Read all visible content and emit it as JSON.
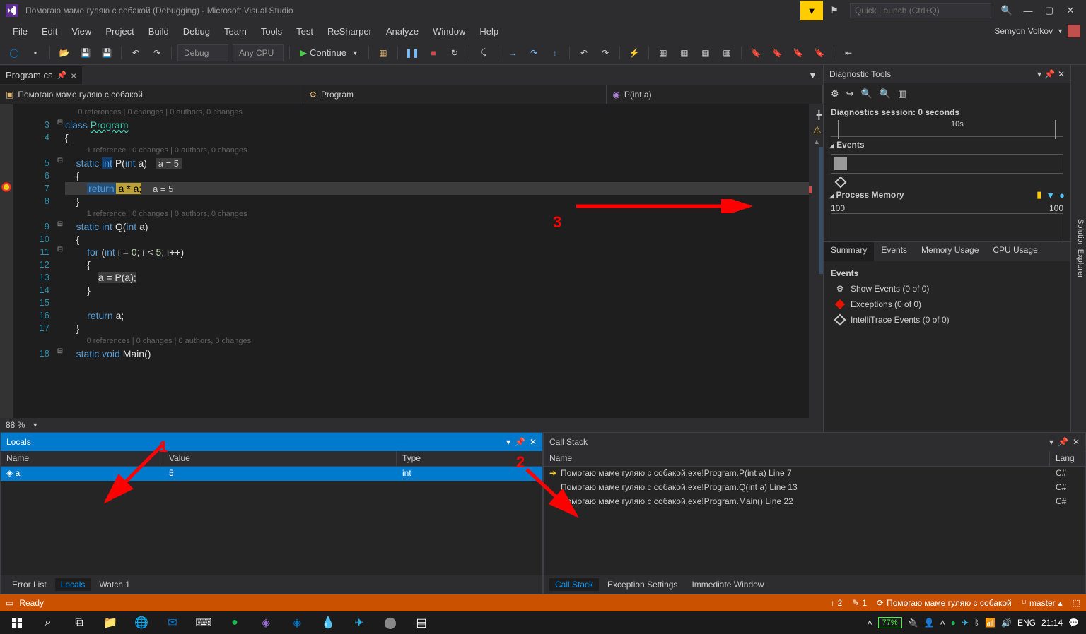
{
  "title": "Помогаю маме гуляю с собакой (Debugging) - Microsoft Visual Studio",
  "quickLaunch": "Quick Launch (Ctrl+Q)",
  "user": "Semyon Volkov",
  "menu": [
    "File",
    "Edit",
    "View",
    "Project",
    "Build",
    "Debug",
    "Team",
    "Tools",
    "Test",
    "ReSharper",
    "Analyze",
    "Window",
    "Help"
  ],
  "toolbar": {
    "config": "Debug",
    "platform": "Any CPU",
    "continue": "Continue"
  },
  "fileTab": "Program.cs",
  "nav": {
    "ns": "Помогаю маме гуляю с собакой",
    "cls": "Program",
    "method": "P(int a)"
  },
  "code": {
    "ref0": "0 references | 0 changes | 0 authors, 0 changes",
    "ref1": "1 reference | 0 changes | 0 authors, 0 changes",
    "hint_a5": "a = 5",
    "lines": {
      "3": "class Program",
      "4": "{",
      "5": "    static int P(int a)",
      "6": "    {",
      "7": "        return a * a;",
      "8": "    }",
      "9": "    static int Q(int a)",
      "10": "    {",
      "11": "        for (int i = 0; i < 5; i++)",
      "12": "        {",
      "13": "            a = P(a);",
      "14": "        }",
      "15": "",
      "16": "        return a;",
      "17": "    }",
      "18": "    static void Main()"
    }
  },
  "zoom": "88 %",
  "diag": {
    "title": "Diagnostic Tools",
    "session": "Diagnostics session: 0 seconds",
    "tlVal": "10s",
    "events": "Events",
    "procMem": "Process Memory",
    "mem100": "100",
    "tabs": [
      "Summary",
      "Events",
      "Memory Usage",
      "CPU Usage"
    ],
    "evHdr": "Events",
    "showEv": "Show Events (0 of 0)",
    "exc": "Exceptions (0 of 0)",
    "intel": "IntelliTrace Events (0 of 0)"
  },
  "solExp": "Solution Explorer",
  "locals": {
    "title": "Locals",
    "cols": [
      "Name",
      "Value",
      "Type"
    ],
    "row": {
      "name": "a",
      "value": "5",
      "type": "int"
    },
    "tabs": [
      "Error List",
      "Locals",
      "Watch 1"
    ]
  },
  "callstack": {
    "title": "Call Stack",
    "cols": [
      "Name",
      "Lang"
    ],
    "rows": [
      {
        "n": "Помогаю маме гуляю с собакой.exe!Program.P(int a) Line 7",
        "l": "C#"
      },
      {
        "n": "Помогаю маме гуляю с собакой.exe!Program.Q(int a) Line 13",
        "l": "C#"
      },
      {
        "n": "Помогаю маме гуляю с собакой.exe!Program.Main() Line 22",
        "l": "C#"
      }
    ],
    "tabs": [
      "Call Stack",
      "Exception Settings",
      "Immediate Window"
    ]
  },
  "status": {
    "ready": "Ready",
    "up": "2",
    "edit": "1",
    "proj": "Помогаю маме гуляю с собакой",
    "branch": "master"
  },
  "taskbar": {
    "battery": "77%",
    "lang": "ENG",
    "time": "21:14"
  },
  "annot": {
    "a1": "1",
    "a2": "2",
    "a3": "3"
  }
}
